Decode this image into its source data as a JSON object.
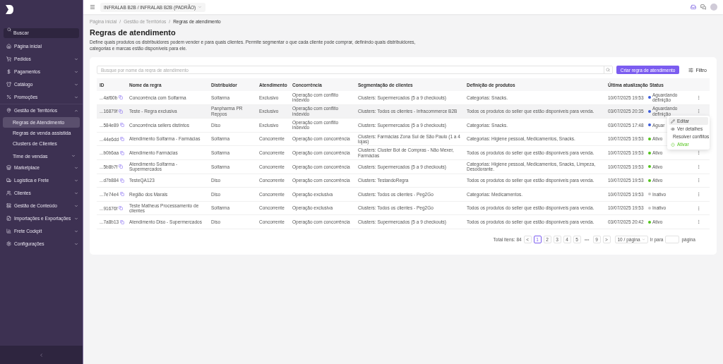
{
  "sidebar": {
    "search": {
      "placeholder": "Buscar"
    },
    "items": [
      {
        "label": "Página inicial"
      },
      {
        "label": "Pedidos",
        "expanded": false
      },
      {
        "label": "Pagamentos",
        "expanded": false
      },
      {
        "label": "Catálogo",
        "expanded": false
      },
      {
        "label": "Promoções",
        "expanded": false
      },
      {
        "label": "Gestão de Territórios",
        "expanded": true,
        "children": [
          {
            "label": "Regras de Atendimento",
            "selected": true
          },
          {
            "label": "Regras de venda assistida",
            "selected": false
          },
          {
            "label": "Clusters de Clientes",
            "selected": false
          },
          {
            "label": "Time de vendas",
            "selected": false,
            "expanded": false
          }
        ]
      },
      {
        "label": "Marketplace",
        "expanded": false
      },
      {
        "label": "Logística e Frete",
        "expanded": false
      },
      {
        "label": "Clientes",
        "expanded": false
      },
      {
        "label": "Gestão de Conteúdo",
        "expanded": false
      },
      {
        "label": "Importações e Exportações",
        "expanded": false
      },
      {
        "label": "Frete Cockpit",
        "expanded": false
      },
      {
        "label": "Configurações",
        "expanded": false
      }
    ]
  },
  "topbar": {
    "store_selector": "INFRALAB B2B / INFRALAB B2B (PADRÃO)"
  },
  "breadcrumb": [
    "Página inicial",
    "Gestão de Territórios",
    "Regras de atendimento"
  ],
  "breadcrumb_separator": "/",
  "title": "Regras de atendimento",
  "description": "Define quais produtos os distribuidores podem vender e para quais clientes. Permite segmentar o que cada cliente pode comprar, definindo quais distribuidores, categorias e marcas estão disponíveis para ele.",
  "search": {
    "placeholder": "Busque por nome da regra de atendimento"
  },
  "create_button": "Criar regra de atendimento",
  "filter_button": "Filtro",
  "table": {
    "columns": [
      "ID",
      "Nome da regra",
      "Distribuidor",
      "Atendimento",
      "Concorrência",
      "Segmentação de clientes",
      "Definição de produtos",
      "Última atualização",
      "Status"
    ],
    "rows": [
      {
        "id": "...4af60b",
        "name": "Concorrência com Solfarma",
        "distributor": "Solfarma",
        "service": "Exclusivo",
        "competition": "Operação com conflito indevido",
        "segmentation": "Clusters: Supermercados (5 a 9 checkouts)",
        "products": "Categorias: Snacks.",
        "updated": "10/07/2025 19:53",
        "status": {
          "label": "Aguardando definição",
          "color": "#3b5bdb"
        },
        "actions": true,
        "hovered": false
      },
      {
        "id": "...16879f",
        "name": "Teste - Regra exclusiva",
        "distributor": "Panpharma PR Reppos",
        "service": "Exclusivo",
        "competition": "Operação com conflito indevido",
        "segmentation": "Clusters: Todos os clientes - Infracommerce B2B",
        "products": "Todos os produtos do seller que estão disponíveis para venda.",
        "updated": "03/07/2025 20:35",
        "status": {
          "label": "Aguardando definição",
          "color": "#3b5bdb"
        },
        "actions": true,
        "hovered": true
      },
      {
        "id": "...584e89",
        "name": "Concorrência sellers distintos",
        "distributor": "Diso",
        "service": "Exclusivo",
        "competition": "Operação com conflito indevido",
        "segmentation": "Clusters: Supermercados (5 a 9 checkouts)",
        "products": "Categorias: Snacks.",
        "updated": "03/07/2025 17:48",
        "status": {
          "label": "Aguar",
          "color": "#3b5bdb"
        },
        "actions": false,
        "hovered": false
      },
      {
        "id": "...44e6dd",
        "name": "Atendimento Solfarma - Farmácias",
        "distributor": "Solfarma",
        "service": "Concorrente",
        "competition": "Operação com concorrência",
        "segmentation": "Clusters: Farmácias Zona Sul de São Paulo (1 a 4 lojas)",
        "products": "Categorias: Higiene pessoal, Medicamentos, Snacks.",
        "updated": "10/07/2025 19:53",
        "status": {
          "label": "Ativo",
          "color": "#52c41a"
        },
        "actions": false,
        "hovered": false
      },
      {
        "id": "...b0b6aa",
        "name": "Atendimento Farmácias",
        "distributor": "Solfarma",
        "service": "Concorrente",
        "competition": "Operação com concorrência",
        "segmentation": "Clusters: Cluster Bot de Compras - Não Mexer, Farmácias",
        "products": "Todos os produtos do seller que estão disponíveis para venda.",
        "updated": "10/07/2025 19:53",
        "status": {
          "label": "Ativo",
          "color": "#52c41a"
        },
        "actions": true,
        "hovered": false
      },
      {
        "id": "...5b8b7f",
        "name": "Atendimento Solfarma - Supermercados",
        "distributor": "Solfarma",
        "service": "Concorrente",
        "competition": "Operação com concorrência",
        "segmentation": "Clusters: Supermercados (5 a 9 checkouts)",
        "products": "Categorias: Higiene pessoal, Medicamentos, Snacks, Limpeza, Desodorante.",
        "updated": "10/07/2025 19:53",
        "status": {
          "label": "Ativo",
          "color": "#52c41a"
        },
        "actions": true,
        "hovered": false
      },
      {
        "id": "...d7b884",
        "name": "TesteQA123",
        "distributor": "Diso",
        "service": "Concorrente",
        "competition": "Operação com concorrência",
        "segmentation": "Clusters: TestandoRegra",
        "products": "Todos os produtos do seller que estão disponíveis para venda.",
        "updated": "10/07/2025 19:53",
        "status": {
          "label": "Ativo",
          "color": "#52c41a"
        },
        "actions": true,
        "hovered": false
      },
      {
        "id": "...7e74e4",
        "name": "Região dos Marais",
        "distributor": "Diso",
        "service": "Concorrente",
        "competition": "Operação exclusiva",
        "segmentation": "Clusters: Todos os clientes - Peg2Go",
        "products": "Categorias: Medicamentos.",
        "updated": "10/07/2025 19:53",
        "status": {
          "label": "Inativo",
          "color": "#c8c8c8"
        },
        "actions": true,
        "hovered": false
      },
      {
        "id": "...91676f",
        "name": "Teste Matheus Processamento de clientes",
        "distributor": "Solfarma",
        "service": "Concorrente",
        "competition": "Operação exclusiva",
        "segmentation": "Clusters: Todos os clientes - Peg2Go",
        "products": "Todos os produtos do seller que estão disponíveis para venda.",
        "updated": "10/07/2025 19:53",
        "status": {
          "label": "Inativo",
          "color": "#c8c8c8"
        },
        "actions": true,
        "hovered": false
      },
      {
        "id": "...7a8b13",
        "name": "Atendimento Diso - Supermercados",
        "distributor": "Diso",
        "service": "Concorrente",
        "competition": "Operação com concorrência",
        "segmentation": "Clusters: Supermercados (5 a 9 checkouts)",
        "products": "Todos os produtos do seller que estão disponíveis para venda.",
        "updated": "03/07/2025 20:42",
        "status": {
          "label": "Ativo",
          "color": "#52c41a"
        },
        "actions": true,
        "hovered": false
      }
    ]
  },
  "row_menu": [
    {
      "label": "Editar",
      "kind": "default",
      "selected": true
    },
    {
      "label": "Ver detalhes",
      "kind": "default",
      "selected": false
    },
    {
      "label": "Resolver conflitos",
      "kind": "default",
      "selected": false
    },
    {
      "label": "Ativar",
      "kind": "success",
      "selected": false
    }
  ],
  "pagination": {
    "total": "Total itens: 84",
    "prev": "<",
    "next": ">",
    "ellipsis": "•••",
    "pages": [
      {
        "label": "1",
        "selected": true
      },
      {
        "label": "2",
        "selected": false
      },
      {
        "label": "3",
        "selected": false
      },
      {
        "label": "4",
        "selected": false
      },
      {
        "label": "5",
        "selected": false
      },
      {
        "label": "9",
        "selected": false
      }
    ],
    "page_size": "10 / página",
    "goto_label": "Ir para",
    "goto_suffix": "página"
  }
}
